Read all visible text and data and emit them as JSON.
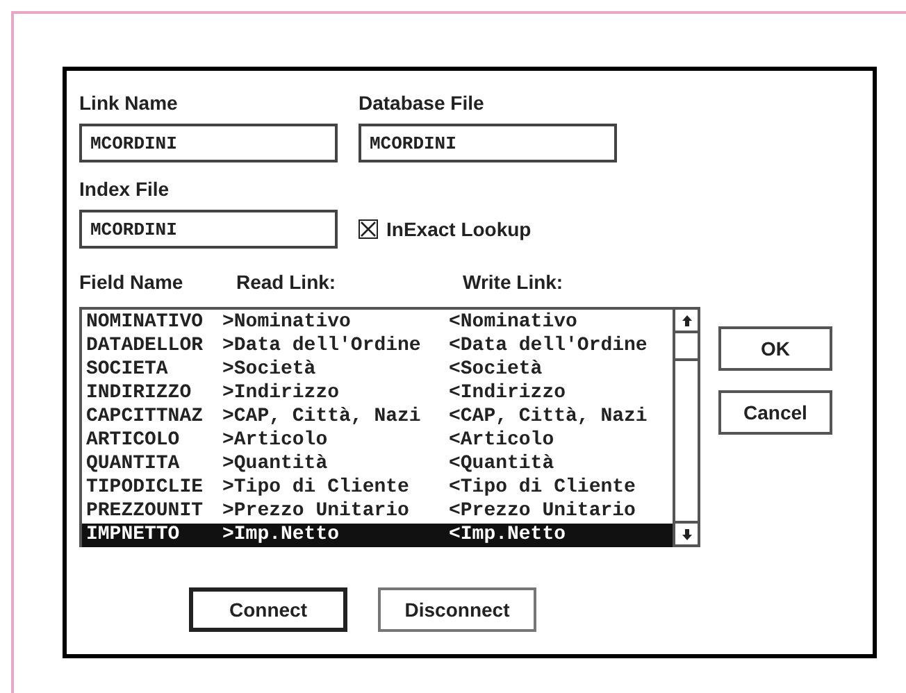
{
  "link_name": {
    "label": "Link Name",
    "value": "MCORDINI"
  },
  "database_file": {
    "label": "Database File",
    "value": "MCORDINI"
  },
  "index_file": {
    "label": "Index File",
    "value": "MCORDINI"
  },
  "inexact_lookup": {
    "label": "InExact Lookup",
    "checked": true
  },
  "list_headers": [
    "Field Name",
    "Read Link:",
    "Write Link:"
  ],
  "rows": [
    {
      "field": "NOMINATIVO",
      "read": ">Nominativo",
      "write": "<Nominativo",
      "selected": false
    },
    {
      "field": "DATADELLOR",
      "read": ">Data dell'Ordine",
      "write": "<Data dell'Ordine",
      "selected": false
    },
    {
      "field": "SOCIETA",
      "read": ">Società",
      "write": "<Società",
      "selected": false
    },
    {
      "field": "INDIRIZZO",
      "read": ">Indirizzo",
      "write": "<Indirizzo",
      "selected": false
    },
    {
      "field": "CAPCITTNAZ",
      "read": ">CAP, Città, Nazi",
      "write": "<CAP, Città, Nazi",
      "selected": false
    },
    {
      "field": "ARTICOLO",
      "read": ">Articolo",
      "write": "<Articolo",
      "selected": false
    },
    {
      "field": "QUANTITA",
      "read": ">Quantità",
      "write": "<Quantità",
      "selected": false
    },
    {
      "field": "TIPODICLIE",
      "read": ">Tipo di Cliente",
      "write": "<Tipo di Cliente",
      "selected": false
    },
    {
      "field": "PREZZOUNIT",
      "read": ">Prezzo Unitario",
      "write": "<Prezzo Unitario",
      "selected": false
    },
    {
      "field": "IMPNETTO",
      "read": ">Imp.Netto",
      "write": "<Imp.Netto",
      "selected": true
    }
  ],
  "side_buttons": [
    "OK",
    "Cancel"
  ],
  "bottom_buttons": [
    {
      "label": "Connect",
      "default": true
    },
    {
      "label": "Disconnect",
      "default": false
    }
  ]
}
